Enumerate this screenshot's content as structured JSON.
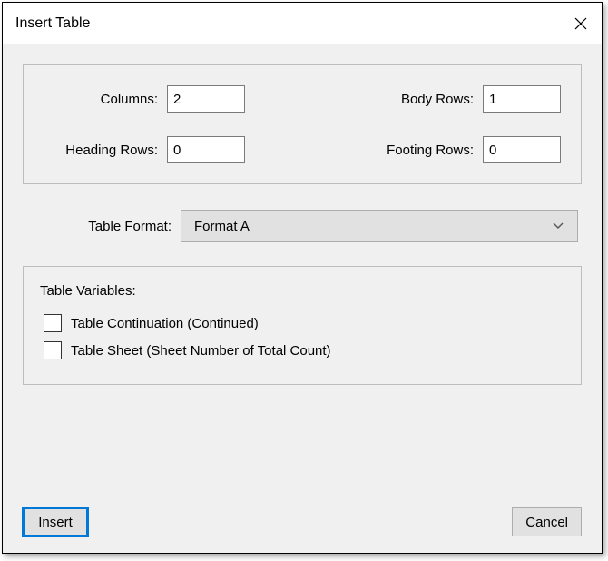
{
  "title": "Insert Table",
  "fields": {
    "columns": {
      "label": "Columns:",
      "value": "2"
    },
    "bodyRows": {
      "label": "Body Rows:",
      "value": "1"
    },
    "headingRows": {
      "label": "Heading Rows:",
      "value": "0"
    },
    "footingRows": {
      "label": "Footing Rows:",
      "value": "0"
    }
  },
  "format": {
    "label": "Table Format:",
    "selected": "Format A"
  },
  "variables": {
    "label": "Table Variables:",
    "continuation": "Table Continuation (Continued)",
    "sheet": "Table Sheet (Sheet Number of Total Count)"
  },
  "buttons": {
    "insert": "Insert",
    "cancel": "Cancel"
  }
}
